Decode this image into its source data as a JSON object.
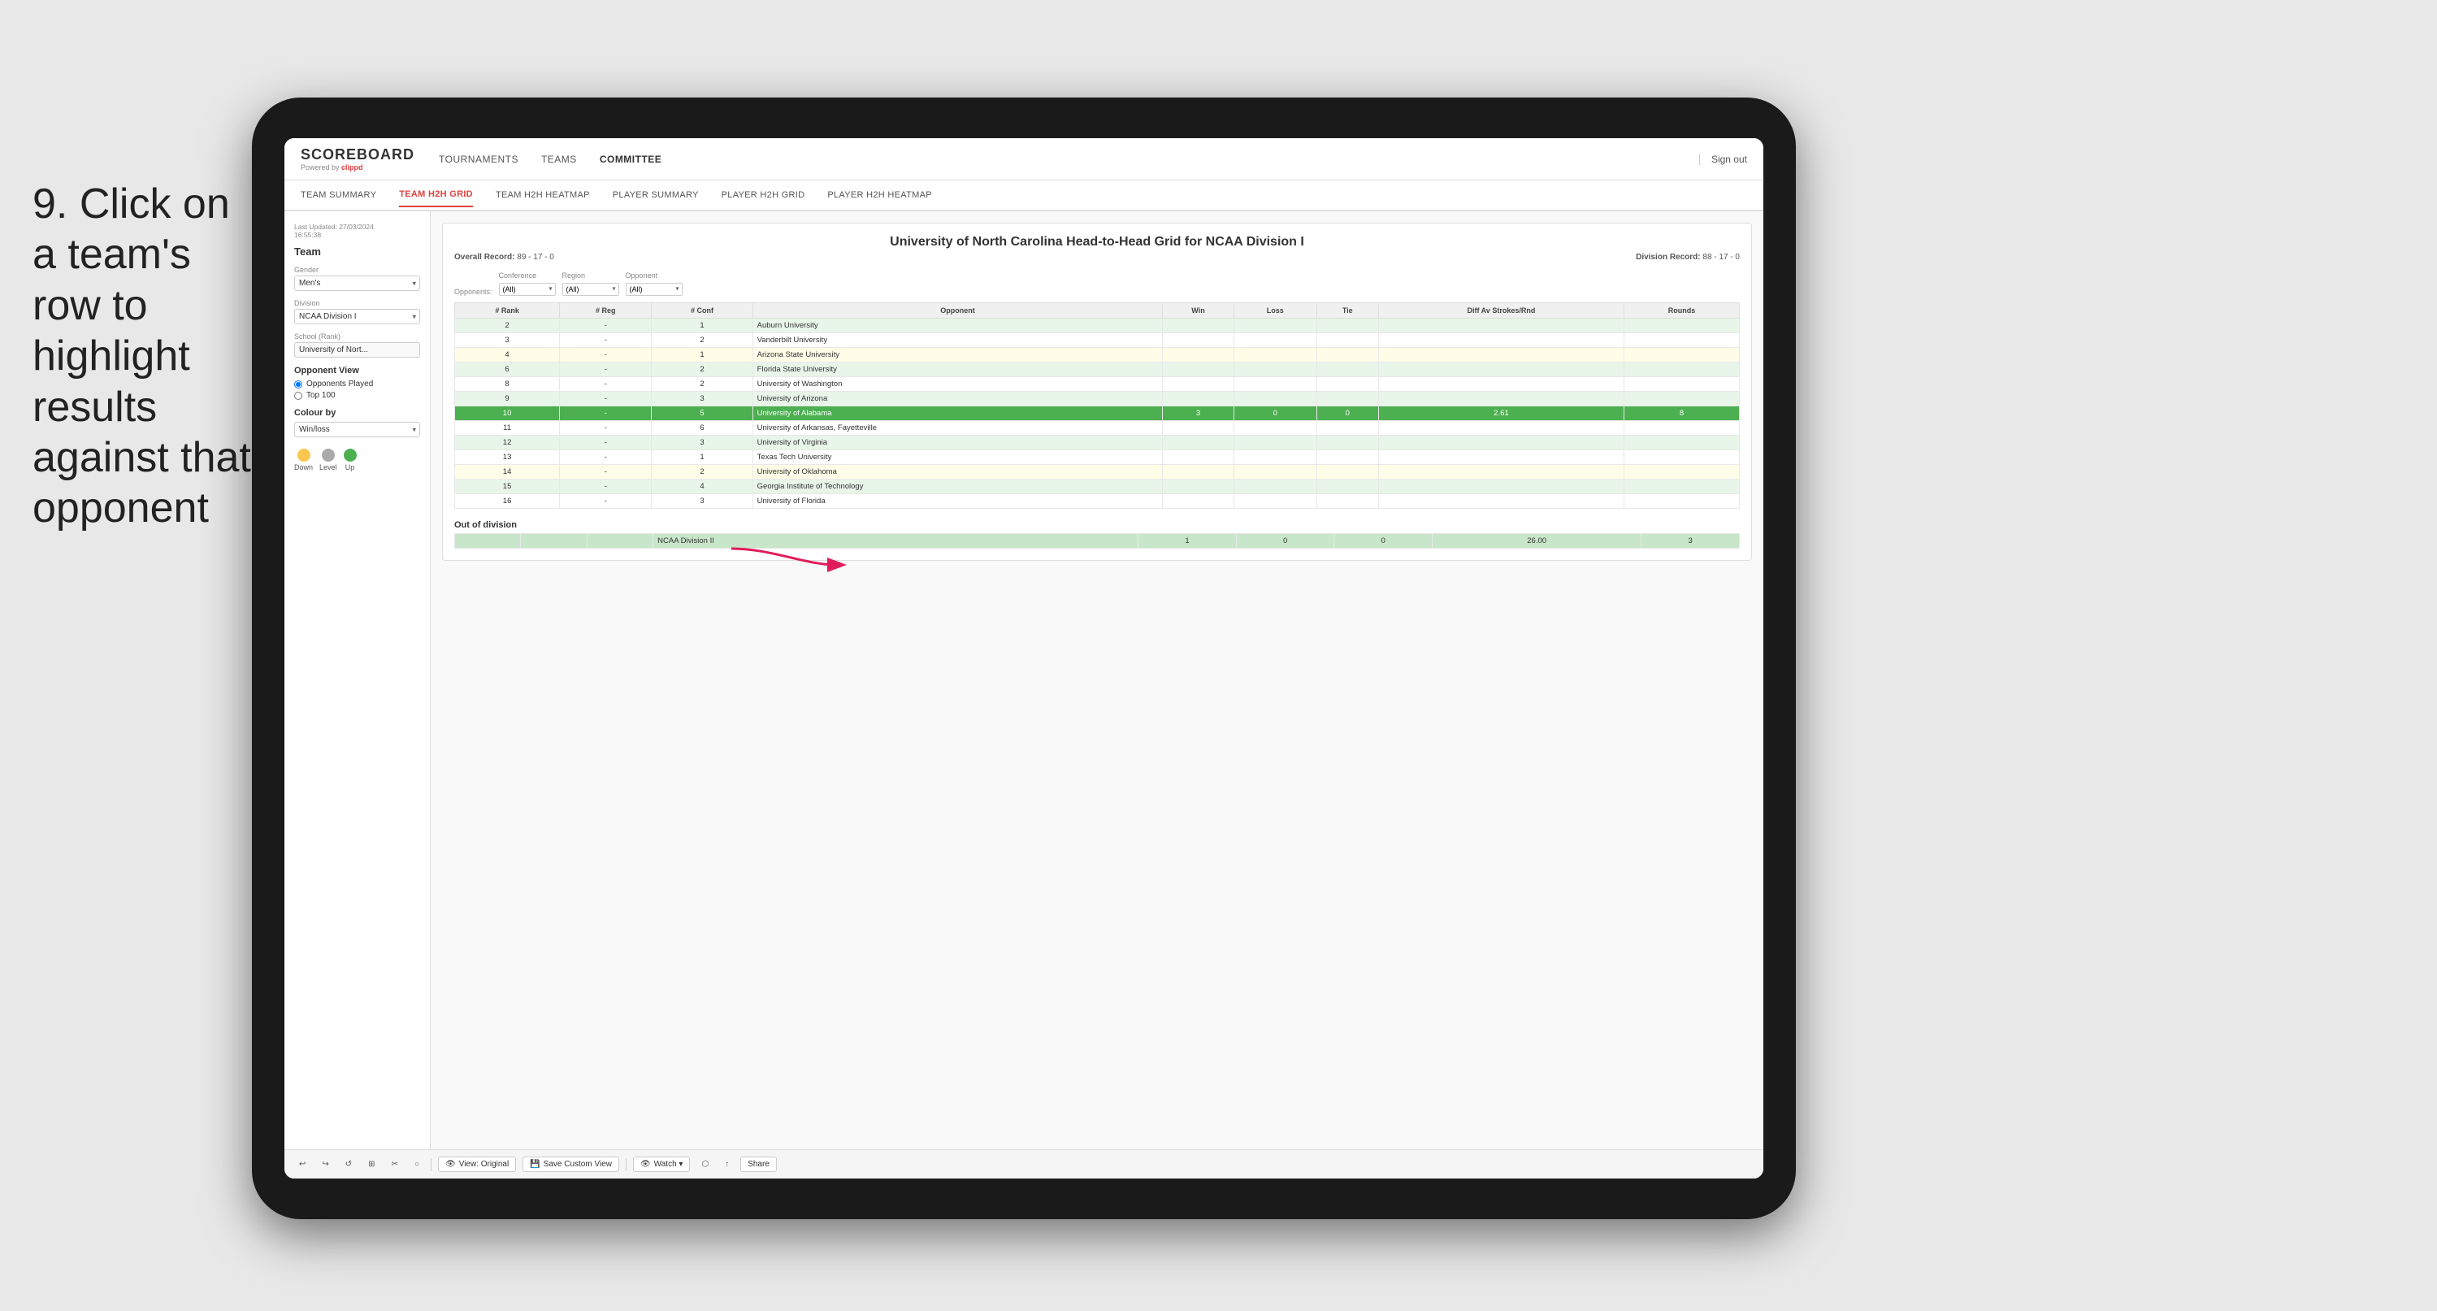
{
  "instruction": {
    "step": "9.",
    "text": "Click on a team's row to highlight results against that opponent"
  },
  "app": {
    "logo": "SCOREBOARD",
    "powered_by": "Powered by",
    "brand": "clippd"
  },
  "top_nav": {
    "links": [
      {
        "label": "TOURNAMENTS",
        "active": false
      },
      {
        "label": "TEAMS",
        "active": false
      },
      {
        "label": "COMMITTEE",
        "active": true
      }
    ],
    "sign_out": "Sign out"
  },
  "sub_nav": {
    "links": [
      {
        "label": "TEAM SUMMARY",
        "active": false
      },
      {
        "label": "TEAM H2H GRID",
        "active": true
      },
      {
        "label": "TEAM H2H HEATMAP",
        "active": false
      },
      {
        "label": "PLAYER SUMMARY",
        "active": false
      },
      {
        "label": "PLAYER H2H GRID",
        "active": false
      },
      {
        "label": "PLAYER H2H HEATMAP",
        "active": false
      }
    ]
  },
  "sidebar": {
    "last_updated_label": "Last Updated: 27/03/2024",
    "last_updated_time": "16:55:38",
    "team_label": "Team",
    "gender_label": "Gender",
    "gender_value": "Men's",
    "division_label": "Division",
    "division_value": "NCAA Division I",
    "school_label": "School (Rank)",
    "school_value": "University of Nort...",
    "opponent_view_title": "Opponent View",
    "radio_options": [
      {
        "label": "Opponents Played",
        "checked": true
      },
      {
        "label": "Top 100",
        "checked": false
      }
    ],
    "colour_by_label": "Colour by",
    "colour_by_value": "Win/loss",
    "legend": [
      {
        "label": "Down",
        "color": "#f9c74f"
      },
      {
        "label": "Level",
        "color": "#aaaaaa"
      },
      {
        "label": "Up",
        "color": "#4caf50"
      }
    ]
  },
  "main_table": {
    "title": "University of North Carolina Head-to-Head Grid for NCAA Division I",
    "overall_record_label": "Overall Record:",
    "overall_record": "89 - 17 - 0",
    "division_record_label": "Division Record:",
    "division_record": "88 - 17 - 0",
    "filters": {
      "opponents_label": "Opponents:",
      "conference_label": "Conference",
      "conference_value": "(All)",
      "region_label": "Region",
      "region_value": "(All)",
      "opponent_label": "Opponent",
      "opponent_value": "(All)"
    },
    "columns": [
      "# Rank",
      "# Reg",
      "# Conf",
      "Opponent",
      "Win",
      "Loss",
      "Tie",
      "Diff Av Strokes/Rnd",
      "Rounds"
    ],
    "rows": [
      {
        "rank": "2",
        "reg": "-",
        "conf": "1",
        "opponent": "Auburn University",
        "win": "",
        "loss": "",
        "tie": "",
        "diff": "",
        "rounds": "",
        "style": "light-green"
      },
      {
        "rank": "3",
        "reg": "-",
        "conf": "2",
        "opponent": "Vanderbilt University",
        "win": "",
        "loss": "",
        "tie": "",
        "diff": "",
        "rounds": "",
        "style": ""
      },
      {
        "rank": "4",
        "reg": "-",
        "conf": "1",
        "opponent": "Arizona State University",
        "win": "",
        "loss": "",
        "tie": "",
        "diff": "",
        "rounds": "",
        "style": "light-yellow"
      },
      {
        "rank": "6",
        "reg": "-",
        "conf": "2",
        "opponent": "Florida State University",
        "win": "",
        "loss": "",
        "tie": "",
        "diff": "",
        "rounds": "",
        "style": "light-green"
      },
      {
        "rank": "8",
        "reg": "-",
        "conf": "2",
        "opponent": "University of Washington",
        "win": "",
        "loss": "",
        "tie": "",
        "diff": "",
        "rounds": "",
        "style": ""
      },
      {
        "rank": "9",
        "reg": "-",
        "conf": "3",
        "opponent": "University of Arizona",
        "win": "",
        "loss": "",
        "tie": "",
        "diff": "",
        "rounds": "",
        "style": "light-green"
      },
      {
        "rank": "10",
        "reg": "-",
        "conf": "5",
        "opponent": "University of Alabama",
        "win": "3",
        "loss": "0",
        "tie": "0",
        "diff": "2.61",
        "rounds": "8",
        "style": "highlight"
      },
      {
        "rank": "11",
        "reg": "-",
        "conf": "6",
        "opponent": "University of Arkansas, Fayetteville",
        "win": "",
        "loss": "",
        "tie": "",
        "diff": "",
        "rounds": "",
        "style": ""
      },
      {
        "rank": "12",
        "reg": "-",
        "conf": "3",
        "opponent": "University of Virginia",
        "win": "",
        "loss": "",
        "tie": "",
        "diff": "",
        "rounds": "",
        "style": "light-green"
      },
      {
        "rank": "13",
        "reg": "-",
        "conf": "1",
        "opponent": "Texas Tech University",
        "win": "",
        "loss": "",
        "tie": "",
        "diff": "",
        "rounds": "",
        "style": ""
      },
      {
        "rank": "14",
        "reg": "-",
        "conf": "2",
        "opponent": "University of Oklahoma",
        "win": "",
        "loss": "",
        "tie": "",
        "diff": "",
        "rounds": "",
        "style": "light-yellow"
      },
      {
        "rank": "15",
        "reg": "-",
        "conf": "4",
        "opponent": "Georgia Institute of Technology",
        "win": "",
        "loss": "",
        "tie": "",
        "diff": "",
        "rounds": "",
        "style": "light-green"
      },
      {
        "rank": "16",
        "reg": "-",
        "conf": "3",
        "opponent": "University of Florida",
        "win": "",
        "loss": "",
        "tie": "",
        "diff": "",
        "rounds": "",
        "style": ""
      }
    ],
    "out_of_division_label": "Out of division",
    "out_of_division_row": {
      "label": "NCAA Division II",
      "win": "1",
      "loss": "0",
      "tie": "0",
      "diff": "26.00",
      "rounds": "3"
    }
  },
  "bottom_toolbar": {
    "buttons": [
      {
        "label": "↩",
        "name": "undo"
      },
      {
        "label": "↪",
        "name": "redo"
      },
      {
        "label": "↩↩",
        "name": "reset"
      },
      {
        "label": "⊞",
        "name": "grid"
      },
      {
        "label": "✂",
        "name": "cut"
      },
      {
        "label": "○",
        "name": "clock"
      },
      {
        "separator": true
      },
      {
        "label": "View: Original",
        "name": "view-original"
      },
      {
        "label": "Save Custom View",
        "name": "save-custom"
      },
      {
        "separator": true
      },
      {
        "label": "Watch ▾",
        "name": "watch"
      },
      {
        "label": "⬡",
        "name": "share-alt"
      },
      {
        "label": "↑",
        "name": "export"
      },
      {
        "label": "Share",
        "name": "share"
      }
    ]
  }
}
